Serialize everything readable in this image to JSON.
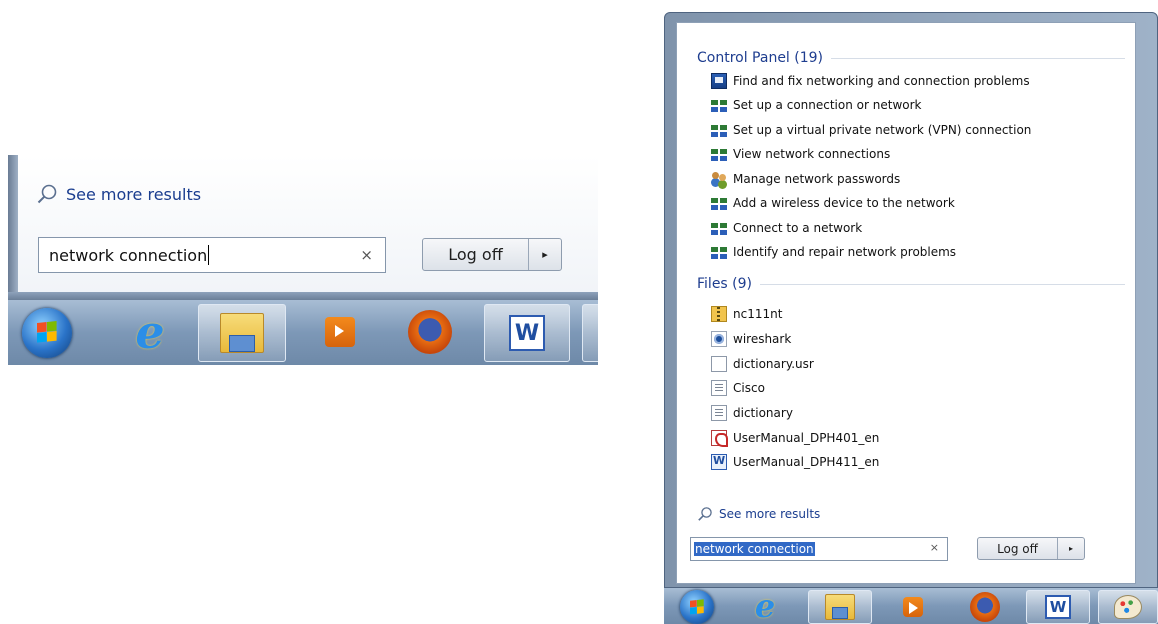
{
  "left_panel": {
    "see_more_label": "See more results",
    "search": {
      "value": "network connection",
      "clear_glyph": "×"
    },
    "logoff": {
      "label": "Log off",
      "arrow_glyph": "▸"
    },
    "taskbar_icons": [
      "start-orb-icon",
      "internet-explorer-icon",
      "windows-explorer-icon",
      "media-player-icon",
      "firefox-icon",
      "word-icon"
    ]
  },
  "start_menu": {
    "control_panel": {
      "heading": "Control Panel (19)",
      "items": [
        {
          "label": "Find and fix networking and connection problems",
          "icon": "troubleshoot-icon"
        },
        {
          "label": "Set up a connection or network",
          "icon": "network-icon"
        },
        {
          "label": "Set up a virtual private network (VPN) connection",
          "icon": "network-icon"
        },
        {
          "label": "View network connections",
          "icon": "network-icon"
        },
        {
          "label": "Manage network passwords",
          "icon": "users-icon"
        },
        {
          "label": "Add a wireless device to the network",
          "icon": "network-icon"
        },
        {
          "label": "Connect to a network",
          "icon": "network-icon"
        },
        {
          "label": "Identify and repair network problems",
          "icon": "network-icon"
        }
      ]
    },
    "files": {
      "heading": "Files (9)",
      "items": [
        {
          "label": "nc111nt",
          "icon": "zip-folder-icon"
        },
        {
          "label": "wireshark",
          "icon": "wireshark-icon"
        },
        {
          "label": "dictionary.usr",
          "icon": "blank-file-icon"
        },
        {
          "label": "Cisco",
          "icon": "text-file-icon"
        },
        {
          "label": "dictionary",
          "icon": "text-file-icon"
        },
        {
          "label": "UserManual_DPH401_en",
          "icon": "pdf-icon"
        },
        {
          "label": "UserManual_DPH411_en",
          "icon": "word-doc-icon"
        }
      ]
    },
    "see_more_label": "See more results",
    "search": {
      "value": "network connection",
      "clear_glyph": "×"
    },
    "logoff": {
      "label": "Log off",
      "arrow_glyph": "▸"
    },
    "taskbar_icons": [
      "start-orb-icon",
      "internet-explorer-icon",
      "windows-explorer-icon",
      "media-player-icon",
      "firefox-icon",
      "word-icon",
      "paint-icon"
    ]
  },
  "colors": {
    "heading_blue": "#1e3d8f",
    "link_blue": "#1a3d8f",
    "selection_blue": "#3169c6",
    "taskbar": "#7d98b7"
  }
}
